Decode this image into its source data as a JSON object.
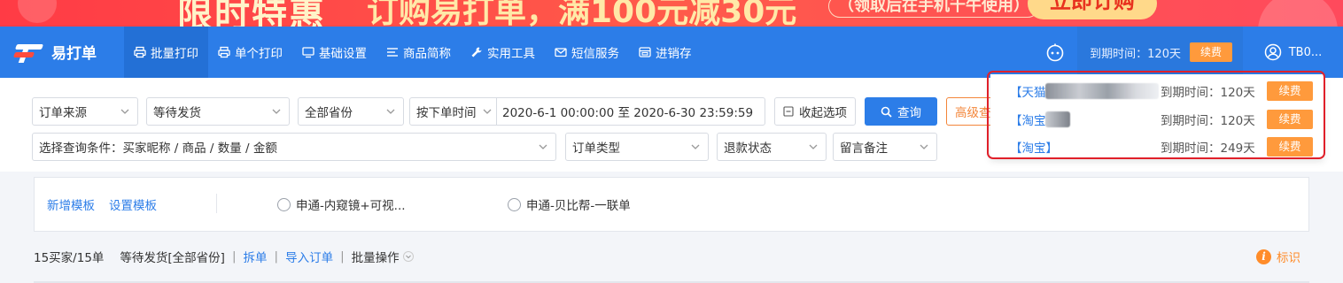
{
  "banner": {
    "headline": "限时特惠",
    "offer": "订购易打单，满100元减30元",
    "note": "（领取后在手机千牛使用）",
    "cta": "立即订购"
  },
  "nav": {
    "logo": "易打单",
    "items": [
      {
        "label": "批量打印",
        "icon": "printer-icon"
      },
      {
        "label": "单个打印",
        "icon": "printer-icon"
      },
      {
        "label": "基础设置",
        "icon": "monitor-icon"
      },
      {
        "label": "商品简称",
        "icon": "list-icon"
      },
      {
        "label": "实用工具",
        "icon": "wrench-icon"
      },
      {
        "label": "短信服务",
        "icon": "mail-icon"
      },
      {
        "label": "进销存",
        "icon": "inventory-icon"
      }
    ],
    "expire_text": "到期时间：120天",
    "renew_label": "续费",
    "user_name": "TB0..."
  },
  "filters": {
    "order_source": "订单来源",
    "order_status": "等待发货",
    "province": "全部省份",
    "time_type": "按下单时间",
    "date_range": "2020-6-1 00:00:00 至 2020-6-30 23:59:59",
    "collapse_label": "收起选项",
    "query_label": "查询",
    "advanced_label": "高级查询",
    "condition": "选择查询条件：买家昵称 / 商品 / 数量 / 金额",
    "order_type": "订单类型",
    "refund_status": "退款状态",
    "remark": "留言备注"
  },
  "templates": {
    "add_label": "新增模板",
    "setup_label": "设置模板",
    "options": [
      "申通-内窥镜+可视...",
      "申通-贝比帮-一联单"
    ]
  },
  "summary": {
    "count": "15买家/15单",
    "status": "等待发货[全部省份]",
    "split": "拆单",
    "import": "导入订单",
    "batch": "批量操作",
    "mark": "标识"
  },
  "popup": {
    "shops": [
      {
        "platform": "【天猫】",
        "expire": "到期时间：120天",
        "renew": "续费"
      },
      {
        "platform": "【淘宝】",
        "expire": "到期时间：120天",
        "renew": "续费"
      },
      {
        "platform": "【淘宝】",
        "expire": "到期时间：249天",
        "renew": "续费"
      }
    ]
  },
  "colors": {
    "nav_blue": "#2c7de8",
    "accent_orange": "#ff9a3c",
    "highlight_red": "#e0202a",
    "banner_red": "#ff4a4a"
  }
}
